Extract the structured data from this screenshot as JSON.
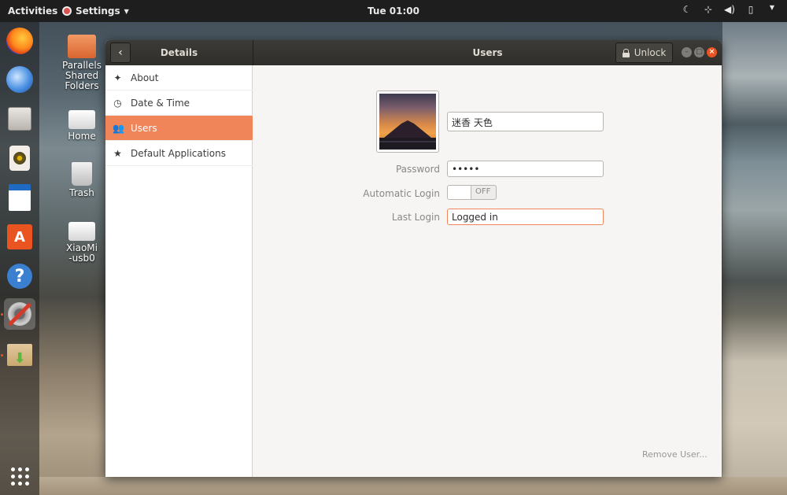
{
  "topbar": {
    "activities": "Activities",
    "app_menu": "Settings",
    "clock": "Tue 01:00"
  },
  "desktop": {
    "icons": [
      {
        "label": "Parallels Shared Folders"
      },
      {
        "label": "Home"
      },
      {
        "label": "Trash"
      },
      {
        "label": "XiaoMi-usb0"
      }
    ]
  },
  "window": {
    "sidebar_title": "Details",
    "title": "Users",
    "unlock_label": "Unlock",
    "sidebar": {
      "items": [
        {
          "label": "About",
          "icon": "sparkle-icon"
        },
        {
          "label": "Date & Time",
          "icon": "clock-icon"
        },
        {
          "label": "Users",
          "icon": "users-icon",
          "selected": true
        },
        {
          "label": "Default Applications",
          "icon": "star-icon"
        }
      ]
    },
    "user": {
      "name": "迷香 天色",
      "password_label": "Password",
      "password_value": "•••••",
      "auto_login_label": "Automatic Login",
      "auto_login_state": "OFF",
      "last_login_label": "Last Login",
      "last_login_value": "Logged in",
      "remove_label": "Remove User..."
    }
  },
  "colors": {
    "accent": "#ef8559",
    "close": "#e95420",
    "titlebar": "#3c3b37"
  }
}
